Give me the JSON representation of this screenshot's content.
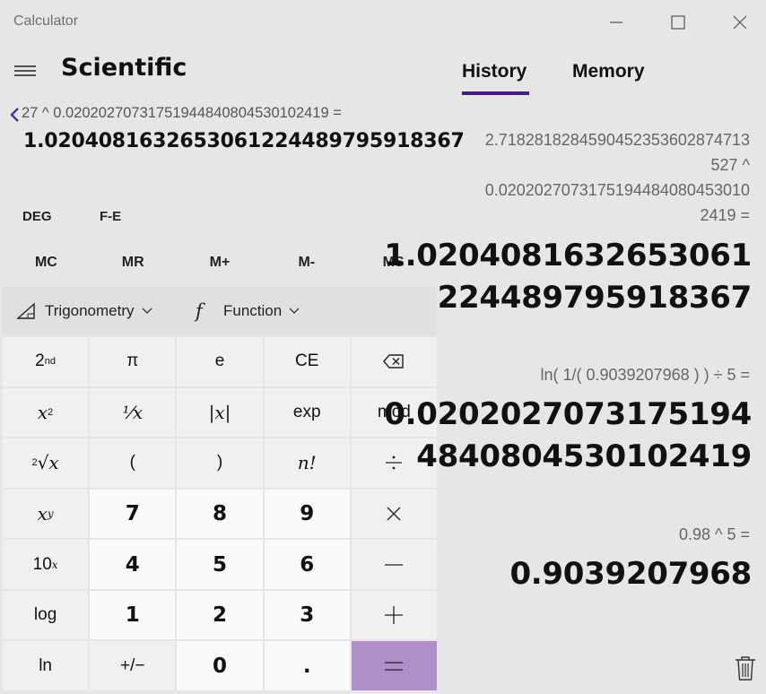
{
  "window": {
    "title": "Calculator"
  },
  "header": {
    "mode_title": "Scientific"
  },
  "display": {
    "expression": "27 ^ 0.0202027073175194484080453010241​9 =",
    "value": "1.0204081632653061224489795918367"
  },
  "mode_buttons": {
    "angle": "DEG",
    "fe": "F-E"
  },
  "memory_buttons": [
    "MC",
    "MR",
    "M+",
    "M-",
    "MS"
  ],
  "toolbar": {
    "trig_label": "Trigonometry",
    "function_label": "Function"
  },
  "keys": {
    "second": "2",
    "second_sup": "nd",
    "pi": "π",
    "e": "e",
    "ce": "CE",
    "square": "x",
    "square_sup": "2",
    "reciprocal": "⅟x",
    "abs": "|x|",
    "exp": "exp",
    "mod": "mod",
    "sqrt_index": "2",
    "sqrt": "√x",
    "lparen": "(",
    "rparen": ")",
    "factorial": "n!",
    "power_base": "x",
    "power_sup": "y",
    "seven": "7",
    "eight": "8",
    "nine": "9",
    "ten_base": "10",
    "ten_sup": "x",
    "four": "4",
    "five": "5",
    "six": "6",
    "log": "log",
    "one": "1",
    "two": "2",
    "three": "3",
    "ln": "ln",
    "negate": "+/−",
    "zero": "0",
    "decimal": "."
  },
  "tabs": {
    "history": "History",
    "memory": "Memory"
  },
  "history": [
    {
      "expression_lines": [
        "2.7182818284590452353602874713",
        "527  ^",
        "0.0202027073175194484080453010",
        "2419 ="
      ],
      "result_lines": [
        "1.0204081632653061",
        "224489795918367"
      ]
    },
    {
      "expression_lines": [
        "ln( 1/( 0.9039207968 ) )   ÷   5 ="
      ],
      "result_lines": [
        "0.0202027073175194",
        "4840804530102419"
      ]
    },
    {
      "expression_lines": [
        "0.98   ^   5 ="
      ],
      "result_lines": [
        "0.9039207968"
      ]
    }
  ],
  "colors": {
    "background": "#e6e6e6",
    "accent": "#4b1a8a",
    "equals": "#ae8fc7"
  }
}
